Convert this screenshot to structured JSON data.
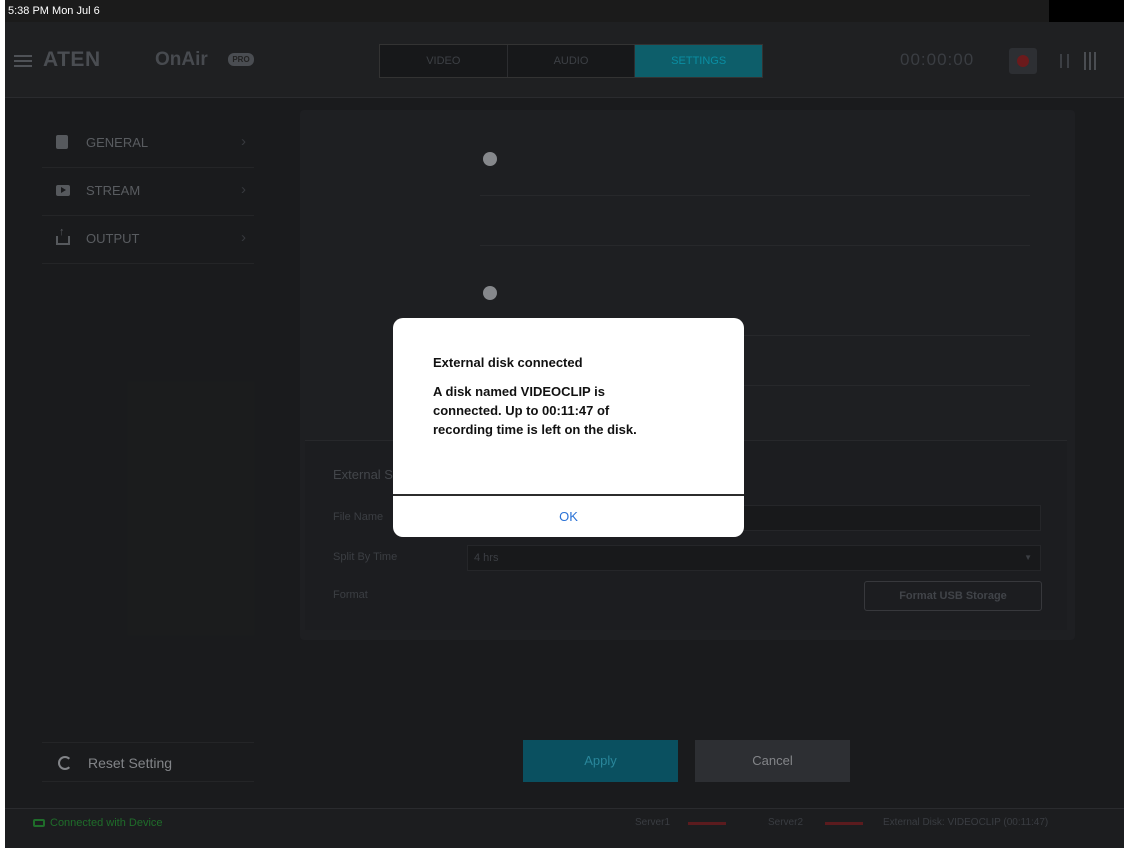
{
  "status_bar": {
    "time": "5:38 PM",
    "date": "Mon Jul 6"
  },
  "app": {
    "brand": "ATEN",
    "product": "OnAir",
    "badge": "PRO"
  },
  "tabs": [
    {
      "label": "VIDEO",
      "active": false
    },
    {
      "label": "AUDIO",
      "active": false
    },
    {
      "label": "SETTINGS",
      "active": true
    }
  ],
  "timer": "00:00:00",
  "sidebar": {
    "items": [
      {
        "label": "GENERAL",
        "icon": "document-icon"
      },
      {
        "label": "STREAM",
        "icon": "stream-icon"
      },
      {
        "label": "OUTPUT",
        "icon": "upload-icon"
      }
    ],
    "reset_label": "Reset Setting"
  },
  "external_storage": {
    "section_title": "External Storage",
    "file_name_label": "File Name",
    "split_label": "Split By Time",
    "split_value": "4 hrs",
    "format_label": "Format",
    "format_button": "Format USB Storage"
  },
  "actions": {
    "apply": "Apply",
    "cancel": "Cancel"
  },
  "footer": {
    "connection": "Connected with Device",
    "server1": "Server1",
    "server2": "Server2",
    "external_disk": "External Disk: VIDEOCLIP (00:11:47)"
  },
  "dialog": {
    "title": "External disk connected",
    "message": "A disk named VIDEOCLIP is\nconnected. Up to 00:11:47 of\nrecording time is left on the disk.",
    "ok_label": "OK"
  },
  "colors": {
    "accent": "#0b5566",
    "dialog_button": "#2a72d6",
    "connected": "#1f6d2a"
  }
}
